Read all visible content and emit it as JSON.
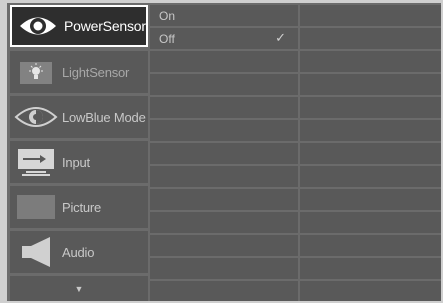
{
  "menu": {
    "items": [
      {
        "label": "PowerSensor",
        "icon": "eye-icon",
        "active": true
      },
      {
        "label": "LightSensor",
        "icon": "light-bulb-icon",
        "active": false
      },
      {
        "label": "LowBlue Mode",
        "icon": "lowblue-eye-icon",
        "active": false
      },
      {
        "label": "Input",
        "icon": "input-arrow-icon",
        "active": false
      },
      {
        "label": "Picture",
        "icon": "picture-icon",
        "active": false
      },
      {
        "label": "Audio",
        "icon": "speaker-icon",
        "active": false
      }
    ],
    "more_indicator": "▼"
  },
  "submenu": {
    "options": [
      {
        "label": "On",
        "selected": false
      },
      {
        "label": "Off",
        "selected": true
      }
    ],
    "check_mark": "✓"
  },
  "colors": {
    "background": "#6b6b6b",
    "cell": "#595959",
    "active_item": "#2e2e2e",
    "active_border": "#ffffff"
  }
}
